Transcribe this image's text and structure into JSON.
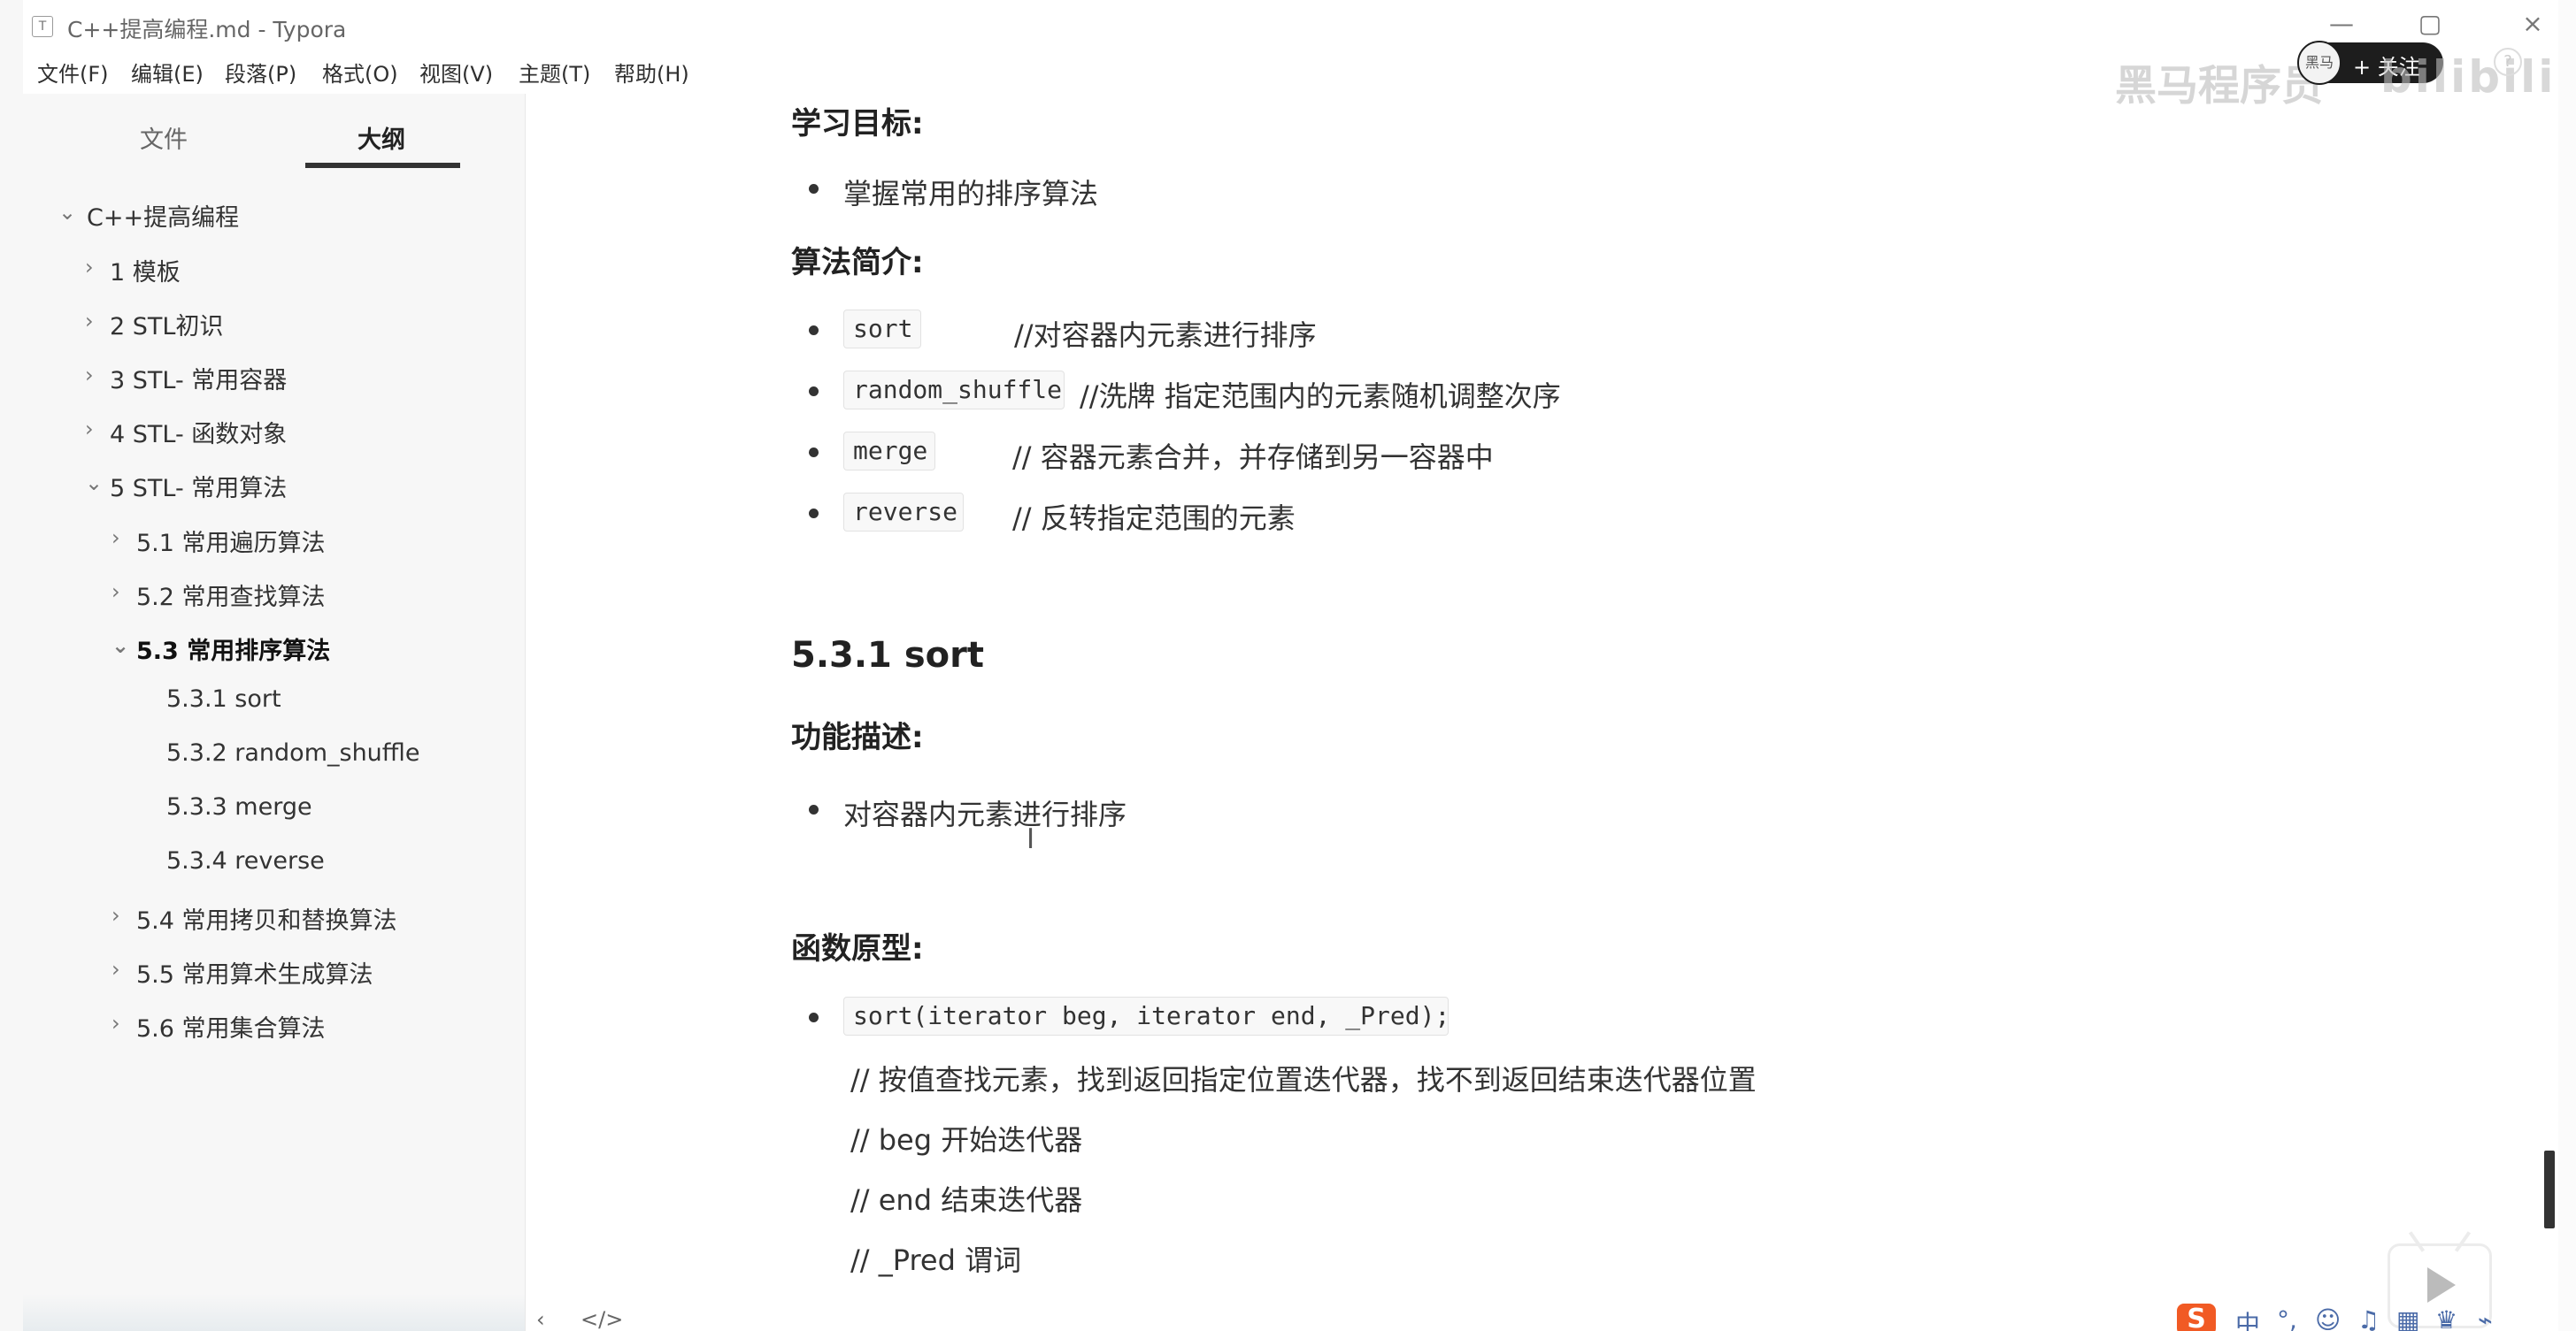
{
  "window": {
    "app_icon": "T",
    "title": "C++提高编程.md - Typora"
  },
  "menu": [
    "文件(F)",
    "编辑(E)",
    "段落(P)",
    "格式(O)",
    "视图(V)",
    "主题(T)",
    "帮助(H)"
  ],
  "sidebar": {
    "tabs": [
      "文件",
      "大纲"
    ],
    "outline": [
      {
        "label": "C++提高编程",
        "chevron": "⌄"
      },
      {
        "label": "1 模板",
        "chevron": "›"
      },
      {
        "label": "2 STL初识",
        "chevron": "›"
      },
      {
        "label": "3 STL- 常用容器",
        "chevron": "›"
      },
      {
        "label": "4 STL- 函数对象",
        "chevron": "›"
      },
      {
        "label": "5 STL- 常用算法",
        "chevron": "⌄"
      },
      {
        "label": "5.1 常用遍历算法",
        "chevron": "›"
      },
      {
        "label": "5.2 常用查找算法",
        "chevron": "›"
      },
      {
        "label": "5.3 常用排序算法",
        "chevron": "⌄"
      },
      {
        "label": "5.3.1 sort",
        "chevron": ""
      },
      {
        "label": "5.3.2 random_shuffle",
        "chevron": ""
      },
      {
        "label": "5.3.3 merge",
        "chevron": ""
      },
      {
        "label": "5.3.4 reverse",
        "chevron": ""
      },
      {
        "label": "5.4 常用拷贝和替换算法",
        "chevron": "›"
      },
      {
        "label": "5.5 常用算术生成算法",
        "chevron": "›"
      },
      {
        "label": "5.6 常用集合算法",
        "chevron": "›"
      }
    ]
  },
  "content": {
    "learning_goal_heading": "学习目标:",
    "learning_goal_item": "掌握常用的排序算法",
    "algorithm_intro_heading": "算法简介:",
    "algorithm_items": [
      {
        "code": "sort",
        "comment": "//对容器内元素进行排序"
      },
      {
        "code": "random_shuffle",
        "comment": "//洗牌   指定范围内的元素随机调整次序"
      },
      {
        "code": "merge",
        "comment": "// 容器元素合并，并存储到另一容器中"
      },
      {
        "code": "reverse",
        "comment": "// 反转指定范围的元素"
      }
    ],
    "section_heading": "5.3.1 sort",
    "function_desc_heading": "功能描述:",
    "function_desc_item": "对容器内元素进行排序",
    "prototype_heading": "函数原型:",
    "prototype_code": "sort(iterator beg, iterator end, _Pred);",
    "prototype_comments": [
      "// 按值查找元素，找到返回指定位置迭代器，找不到返回结束迭代器位置",
      "//  beg    开始迭代器",
      "//  end    结束迭代器",
      "// _Pred  谓词"
    ],
    "cursor_glyph": "I"
  },
  "overlay": {
    "brand": "黑马程序员",
    "follow_avatar": "黑马",
    "follow": "+ 关注",
    "bilibili": "bilibili",
    "help": "?"
  },
  "footer": {
    "nav_left": "‹",
    "nav_source": "</>"
  },
  "tray": {
    "ime_logo": "S",
    "ime_mode": "中",
    "punctuation": "°,",
    "emoji": "☺",
    "mic": "♫",
    "keyboard": "▦",
    "shirt": "♛",
    "tools": "⌁"
  },
  "controls": {
    "minimize": "—",
    "restore": "▢",
    "close": "×"
  },
  "colors": {
    "sidebar_bg": "#f7f7f7",
    "code_bg": "#f8f8f8",
    "ime_orange": "#f15a24",
    "active_tab_underline": "#333333"
  }
}
